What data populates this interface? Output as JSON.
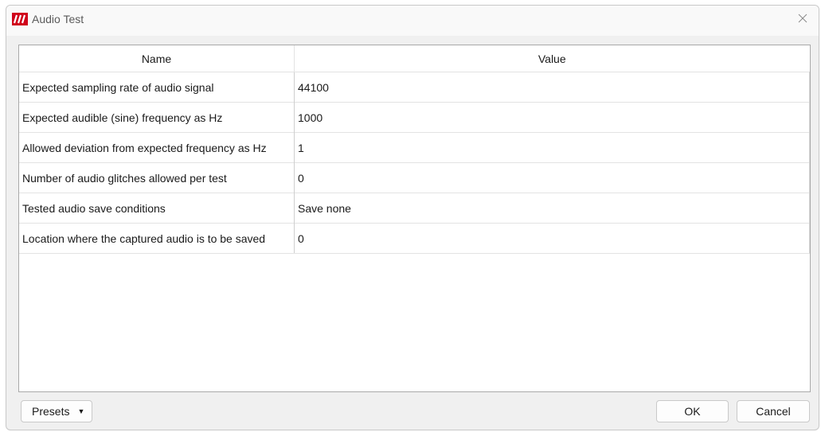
{
  "window": {
    "title": "Audio Test",
    "close_icon": "close-icon",
    "brand_color": "#d0021b"
  },
  "table": {
    "columns": [
      "Name",
      "Value"
    ],
    "rows": [
      {
        "name": "Expected sampling rate of audio signal",
        "value": "44100"
      },
      {
        "name": "Expected audible (sine) frequency as Hz",
        "value": "1000"
      },
      {
        "name": "Allowed deviation from expected frequency as Hz",
        "value": "1"
      },
      {
        "name": "Number of audio glitches allowed per test",
        "value": "0"
      },
      {
        "name": "Tested audio save conditions",
        "value": "Save none"
      },
      {
        "name": "Location where the captured audio is to be saved",
        "value": "0"
      }
    ]
  },
  "footer": {
    "presets_label": "Presets",
    "presets_icon": "caret-down-icon",
    "ok_label": "OK",
    "cancel_label": "Cancel"
  }
}
